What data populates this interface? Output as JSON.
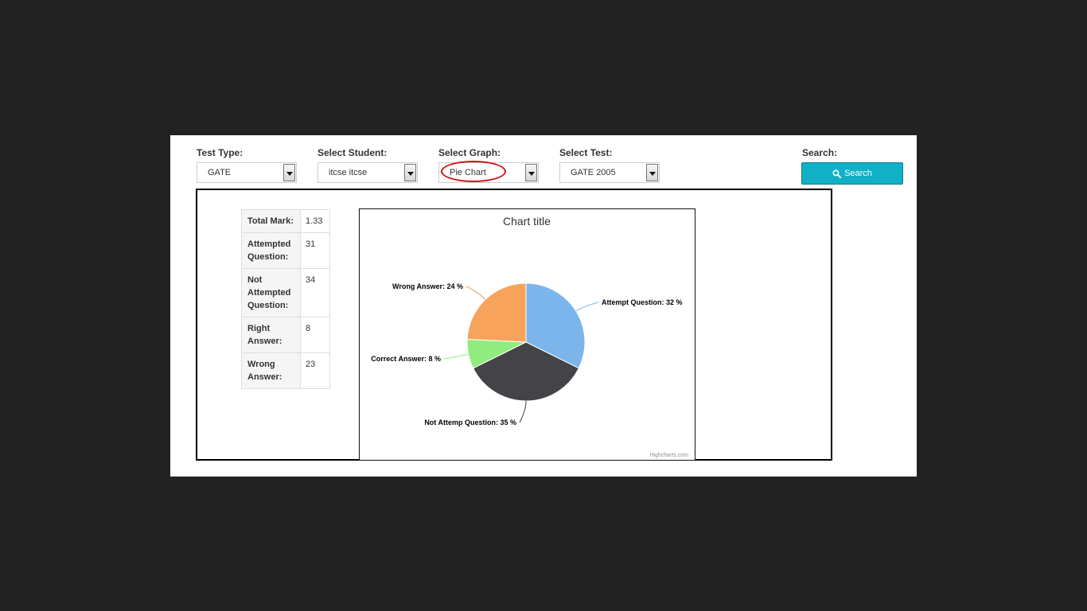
{
  "filters": {
    "test_type": {
      "label": "Test Type:",
      "value": "GATE"
    },
    "student": {
      "label": "Select Student:",
      "value": "itcse itcse"
    },
    "graph": {
      "label": "Select Graph:",
      "value": "Pie Chart"
    },
    "test": {
      "label": "Select Test:",
      "value": "GATE 2005"
    },
    "search": {
      "label": "Search:",
      "button_label": "Search",
      "icon": "search-icon"
    }
  },
  "stats": [
    {
      "label": "Total Mark:",
      "value": "1.33"
    },
    {
      "label": "Attempted Question:",
      "value": "31"
    },
    {
      "label": "Not Attempted Question:",
      "value": "34"
    },
    {
      "label": "Right Answer:",
      "value": "8"
    },
    {
      "label": "Wrong Answer:",
      "value": "23"
    }
  ],
  "colors": {
    "accent": "#10b1c6",
    "highlight_ring": "#d0121d"
  },
  "chart_data": {
    "type": "pie",
    "title": "Chart title",
    "credits": "Highcharts.com",
    "slices": [
      {
        "name": "Attempt Question",
        "value": 32,
        "label": "Attempt Question: 32 %",
        "color": "#7cb5ec"
      },
      {
        "name": "Not Attemp Question",
        "value": 35,
        "label": "Not Attemp Question: 35 %",
        "color": "#434348"
      },
      {
        "name": "Correct Answer",
        "value": 8,
        "label": "Correct Answer: 8 %",
        "color": "#90ed7d"
      },
      {
        "name": "Wrong Answer",
        "value": 24,
        "label": "Wrong Answer: 24 %",
        "color": "#f7a35c"
      }
    ]
  }
}
